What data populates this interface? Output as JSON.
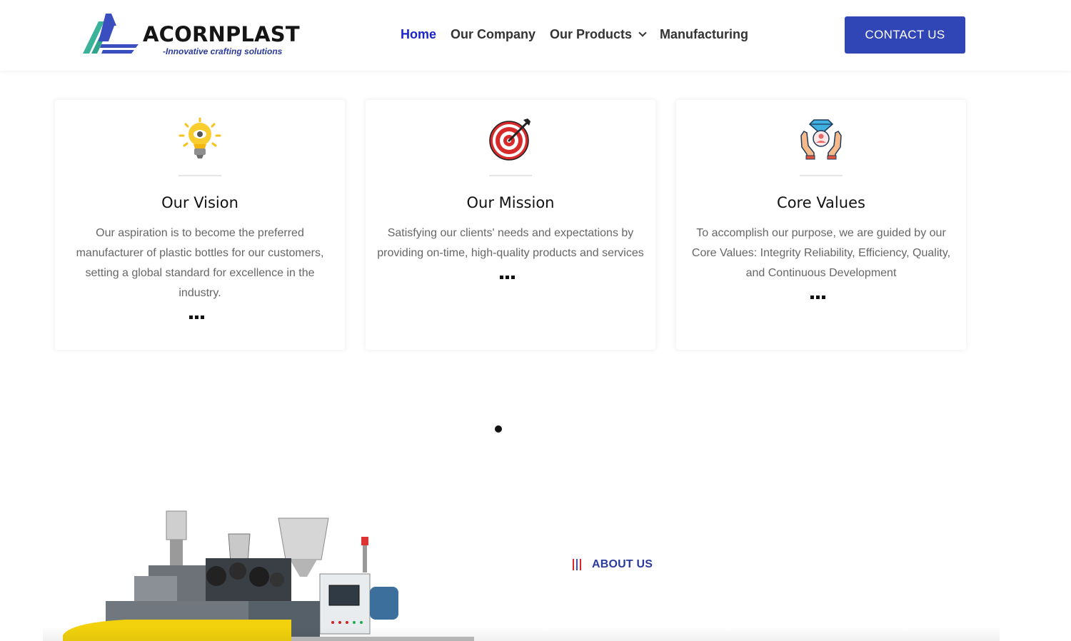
{
  "header": {
    "logo_name": "ACORNPLAST",
    "logo_tagline": "-Innovative crafting solutions",
    "nav": [
      {
        "label": "Home",
        "active": true
      },
      {
        "label": "Our Company",
        "active": false
      },
      {
        "label": "Our Products",
        "active": false,
        "dropdown": true
      },
      {
        "label": "Manufacturing",
        "active": false
      }
    ],
    "contact_label": "CONTACT US"
  },
  "cards": [
    {
      "icon": "lightbulb-icon",
      "title": "Our Vision",
      "text": "Our aspiration is to become the preferred manufacturer of plastic bottles for our customers, setting a global standard for excellence in the industry."
    },
    {
      "icon": "target-icon",
      "title": "Our Mission",
      "text": "Satisfying our clients' needs and expectations by providing on-time, high-quality products and services"
    },
    {
      "icon": "hands-diamond-icon",
      "title": "Core Values",
      "text": "To accomplish our purpose, we are guided by our Core Values: Integrity Reliability, Efficiency, Quality, and Continuous Development"
    }
  ],
  "about": {
    "label": "ABOUT US"
  },
  "colors": {
    "accent": "#3146b6",
    "nav_active": "#1a24c8",
    "about_bar": "#d8262b"
  }
}
